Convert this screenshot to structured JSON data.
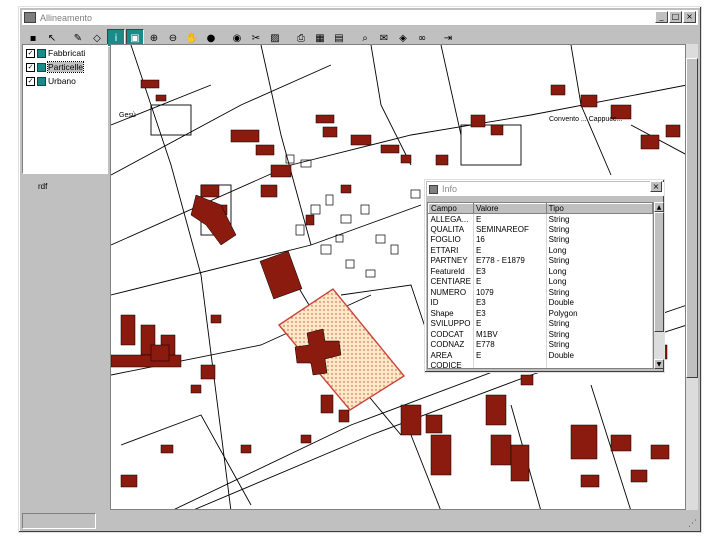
{
  "window": {
    "title": "Allineamento"
  },
  "title_buttons": [
    "_",
    "□",
    "×"
  ],
  "toolbar": [
    {
      "name": "select-tool-icon",
      "glyph": "▪",
      "pressed": false
    },
    {
      "name": "pointer-tool-icon",
      "glyph": "↖",
      "pressed": false
    },
    {
      "name": "pen-tool-icon",
      "glyph": "✎",
      "pressed": false
    },
    {
      "name": "polygon-tool-icon",
      "glyph": "◇",
      "pressed": false
    },
    {
      "name": "identify-tool-icon",
      "glyph": "i",
      "pressed": true
    },
    {
      "name": "layer-tool-icon",
      "glyph": "▣",
      "pressed": true
    },
    {
      "name": "zoom-in-icon",
      "glyph": "⊕",
      "pressed": false
    },
    {
      "name": "zoom-out-icon",
      "glyph": "⊖",
      "pressed": false
    },
    {
      "name": "pan-icon",
      "glyph": "✋",
      "pressed": false
    },
    {
      "name": "stop-icon",
      "glyph": "●",
      "pressed": false
    },
    {
      "name": "globe-icon",
      "glyph": "◉",
      "pressed": false
    },
    {
      "name": "scissors-icon",
      "glyph": "✂",
      "pressed": false
    },
    {
      "name": "hatch-icon",
      "glyph": "▨",
      "pressed": false
    },
    {
      "name": "printer-icon",
      "glyph": "⎙",
      "pressed": false
    },
    {
      "name": "table-icon",
      "glyph": "▦",
      "pressed": false
    },
    {
      "name": "document-icon",
      "glyph": "▤",
      "pressed": false
    },
    {
      "name": "query-icon",
      "glyph": "⌕",
      "pressed": false
    },
    {
      "name": "message-icon",
      "glyph": "✉",
      "pressed": false
    },
    {
      "name": "chart-icon",
      "glyph": "◈",
      "pressed": false
    },
    {
      "name": "binoculars-icon",
      "glyph": "∞",
      "pressed": false
    },
    {
      "name": "exit-icon",
      "glyph": "⇥",
      "pressed": false
    }
  ],
  "layers": [
    {
      "label": "Fabbricati",
      "checked": true,
      "selected": false
    },
    {
      "label": "Particelle",
      "checked": true,
      "selected": true
    },
    {
      "label": "Urbano",
      "checked": true,
      "selected": false
    }
  ],
  "side_label": "rdf",
  "map_labels": [
    "Gesù",
    "Convento ... Cappucc..."
  ],
  "info": {
    "title": "Info",
    "columns": [
      "Campo",
      "Valore",
      "Tipo"
    ],
    "rows": [
      [
        "ALLEGA...",
        "E",
        "String"
      ],
      [
        "QUALITA",
        "SEMINAREOF",
        "String"
      ],
      [
        "FOGLIO",
        "16",
        "String"
      ],
      [
        "ETTARI",
        "E",
        "Long"
      ],
      [
        "PARTNEY",
        "E778 - E1879",
        "String"
      ],
      [
        "FeatureId",
        "E3",
        "Long"
      ],
      [
        "CENTIARE",
        "E",
        "Long"
      ],
      [
        "NUMERO",
        "1079",
        "String"
      ],
      [
        "ID",
        "E3",
        "Double"
      ],
      [
        "Shape",
        "E3",
        "Polygon"
      ],
      [
        "SVILUPPO",
        "E",
        "String"
      ],
      [
        "CODCAT",
        "M1BV",
        "String"
      ],
      [
        "CODNAZ",
        "E778",
        "String"
      ],
      [
        "AREA",
        "E",
        "Double"
      ],
      [
        "CODICE",
        "",
        ""
      ]
    ]
  },
  "colors": {
    "parcel_fill": "#8b1a0f",
    "accent": "#1a8a8a"
  }
}
